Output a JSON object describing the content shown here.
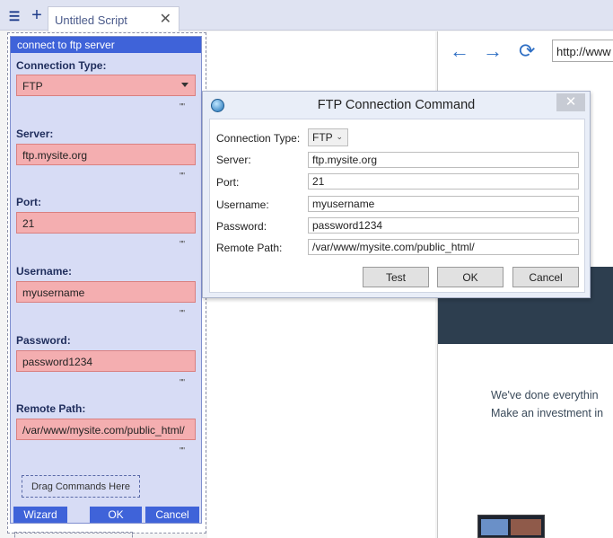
{
  "tabbar": {
    "menu_icon": "hamburger-icon",
    "add_icon": "plus-icon",
    "tab_title": "Untitled Script",
    "tab_close": "✕"
  },
  "panel": {
    "title": "connect to ftp server",
    "fields": [
      {
        "label": "Connection Type:",
        "value": "FTP"
      },
      {
        "label": "Server:",
        "value": "ftp.mysite.org"
      },
      {
        "label": "Port:",
        "value": "21"
      },
      {
        "label": "Username:",
        "value": "myusername"
      },
      {
        "label": "Password:",
        "value": "password1234"
      },
      {
        "label": "Remote Path:",
        "value": "/var/www/mysite.com/public_html/"
      }
    ],
    "quote_mark": "\"\"",
    "drag_hint": "Drag Commands Here",
    "buttons": {
      "wizard": "Wizard",
      "ok": "OK",
      "cancel": "Cancel"
    }
  },
  "browser": {
    "back_icon": "←",
    "forward_icon": "→",
    "refresh_icon": "⟳",
    "url": "http://www",
    "promo_line1": "We've done everythin",
    "promo_line2": "Make an investment in"
  },
  "dialog": {
    "title": "FTP Connection Command",
    "close": "✕",
    "labels": {
      "connection_type": "Connection Type:",
      "server": "Server:",
      "port": "Port:",
      "username": "Username:",
      "password": "Password:",
      "remote_path": "Remote Path:"
    },
    "values": {
      "connection_type": "FTP",
      "server": "ftp.mysite.org",
      "port": "21",
      "username": "myusername",
      "password": "password1234",
      "remote_path": "/var/www/mysite.com/public_html/"
    },
    "buttons": {
      "test": "Test",
      "ok": "OK",
      "cancel": "Cancel"
    }
  }
}
